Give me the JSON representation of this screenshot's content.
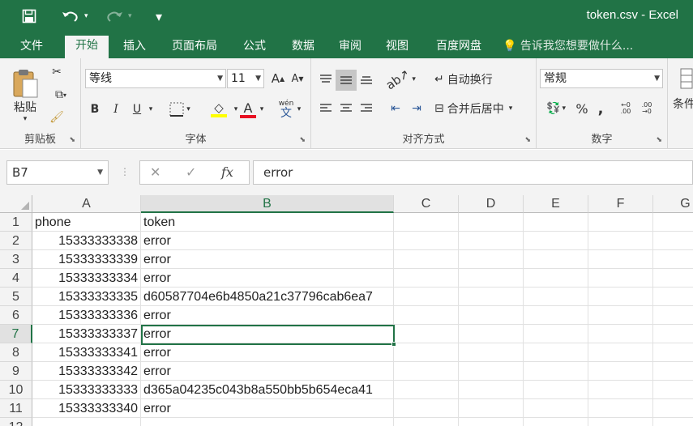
{
  "titlebar": {
    "title": "token.csv  -  Excel"
  },
  "ribbon_tabs": [
    "文件",
    "开始",
    "插入",
    "页面布局",
    "公式",
    "数据",
    "审阅",
    "视图",
    "百度网盘"
  ],
  "tell_me": "告诉我您想要做什么...",
  "clipboard": {
    "paste_label": "粘贴",
    "group_label": "剪贴板"
  },
  "font": {
    "name": "等线",
    "size": "11",
    "group_label": "字体",
    "grow": "A",
    "shrink": "A",
    "bold": "B",
    "italic": "I",
    "underline": "U",
    "font_color": "A",
    "phonetic": "wén"
  },
  "alignment": {
    "wrap_text": "自动换行",
    "merge_center": "合并后居中",
    "group_label": "对齐方式"
  },
  "number": {
    "format": "常规",
    "group_label": "数字",
    "percent": "%",
    "comma": ","
  },
  "styles": {
    "group_label": "条件"
  },
  "formula_bar": {
    "name_box": "B7",
    "fx": "fx",
    "value": "error"
  },
  "sheet": {
    "columns": [
      "A",
      "B",
      "C",
      "D",
      "E",
      "F",
      "G"
    ],
    "selected_column": "B",
    "selected_row": "7",
    "rows": [
      {
        "num": "1",
        "a": "phone",
        "b": "token"
      },
      {
        "num": "2",
        "a": "15333333338",
        "b": "error"
      },
      {
        "num": "3",
        "a": "15333333339",
        "b": "error"
      },
      {
        "num": "4",
        "a": "15333333334",
        "b": "error"
      },
      {
        "num": "5",
        "a": "15333333335",
        "b": "d60587704e6b4850a21c37796cab6ea7"
      },
      {
        "num": "6",
        "a": "15333333336",
        "b": "error"
      },
      {
        "num": "7",
        "a": "15333333337",
        "b": "error"
      },
      {
        "num": "8",
        "a": "15333333341",
        "b": "error"
      },
      {
        "num": "9",
        "a": "15333333342",
        "b": "error"
      },
      {
        "num": "10",
        "a": "15333333333",
        "b": "d365a04235c043b8a550bb5b654eca41"
      },
      {
        "num": "11",
        "a": "15333333340",
        "b": "error"
      },
      {
        "num": "12",
        "a": "",
        "b": ""
      }
    ]
  },
  "colors": {
    "accent": "#217346",
    "font_color_bar": "#e81123",
    "highlight_bar": "#ffff00"
  }
}
